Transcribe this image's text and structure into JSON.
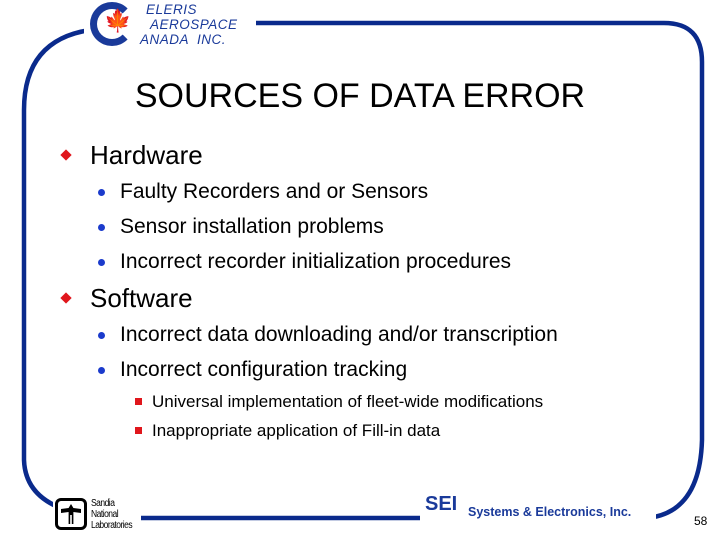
{
  "header": {
    "company_logo": {
      "icon": "maple-leaf-icon",
      "lines": [
        "ELERIS",
        "AEROSPACE",
        "ANADA  INC."
      ]
    }
  },
  "slide": {
    "title": "SOURCES OF DATA ERROR",
    "bullets": [
      {
        "label": "Hardware",
        "items": [
          {
            "label": "Faulty Recorders and or Sensors"
          },
          {
            "label": "Sensor installation problems"
          },
          {
            "label": "Incorrect recorder initialization procedures"
          }
        ]
      },
      {
        "label": "Software",
        "items": [
          {
            "label": "Incorrect data downloading and/or transcription"
          },
          {
            "label": "Incorrect configuration tracking",
            "items": [
              {
                "label": "Universal implementation of fleet-wide modifications"
              },
              {
                "label": "Inappropriate application of Fill-in data"
              }
            ]
          }
        ]
      }
    ]
  },
  "footer": {
    "sandia_logo": {
      "lines": [
        "Sandia",
        "National",
        "Laboratories"
      ]
    },
    "sei_logo": {
      "abbr": "SEI",
      "name": "Systems & Electronics, Inc."
    },
    "page_number": "58"
  },
  "colors": {
    "frame": "#0a2a8c",
    "level1_bullet": "#e0161c",
    "level2_bullet": "#1b3bcc",
    "level3_bullet": "#e0161c",
    "logo_blue": "#1a3a9a",
    "maple_red": "#e0161c"
  }
}
